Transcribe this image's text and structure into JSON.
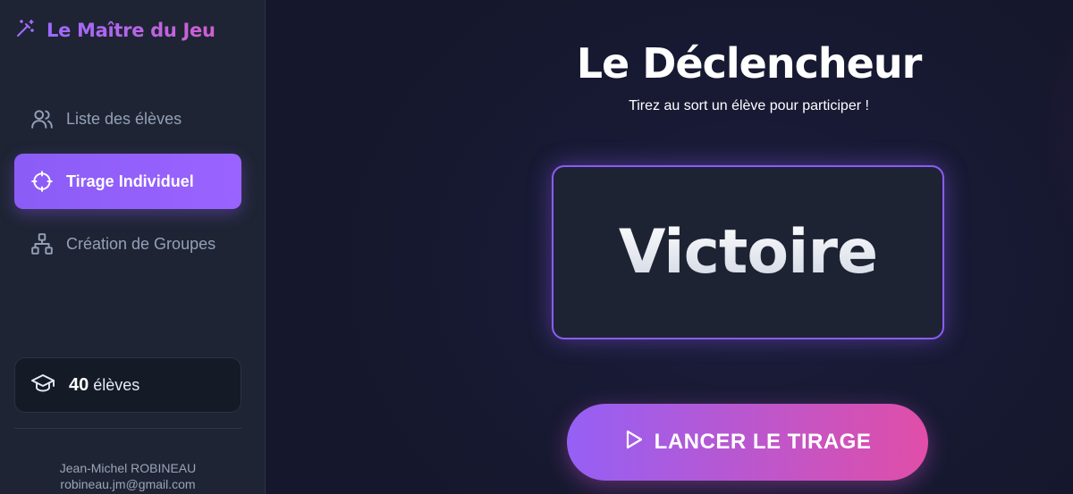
{
  "app": {
    "brand": "Le Maître du Jeu",
    "brand_icon": "magic-wand-icon"
  },
  "sidebar": {
    "items": [
      {
        "label": "Liste des élèves",
        "icon": "users-icon",
        "active": false
      },
      {
        "label": "Tirage Individuel",
        "icon": "target-icon",
        "active": true
      },
      {
        "label": "Création de Groupes",
        "icon": "sitemap-icon",
        "active": false
      }
    ],
    "student_count": {
      "icon": "graduation-cap-icon",
      "number": "40",
      "label": "élèves"
    },
    "user": {
      "name": "Jean-Michel ROBINEAU",
      "email": "robineau.jm@gmail.com"
    }
  },
  "main": {
    "title": "Le Déclencheur",
    "subtitle": "Tirez au sort un élève pour participer !",
    "result": "Victoire",
    "launch_button": {
      "label": "LANCER LE TIRAGE",
      "icon": "play-icon"
    }
  },
  "colors": {
    "accent": "#8b5cf6",
    "accent_pink": "#e04ea8",
    "sidebar_bg": "#1e2433",
    "main_bg": "#15172c",
    "nav_text": "#94a0b8"
  }
}
